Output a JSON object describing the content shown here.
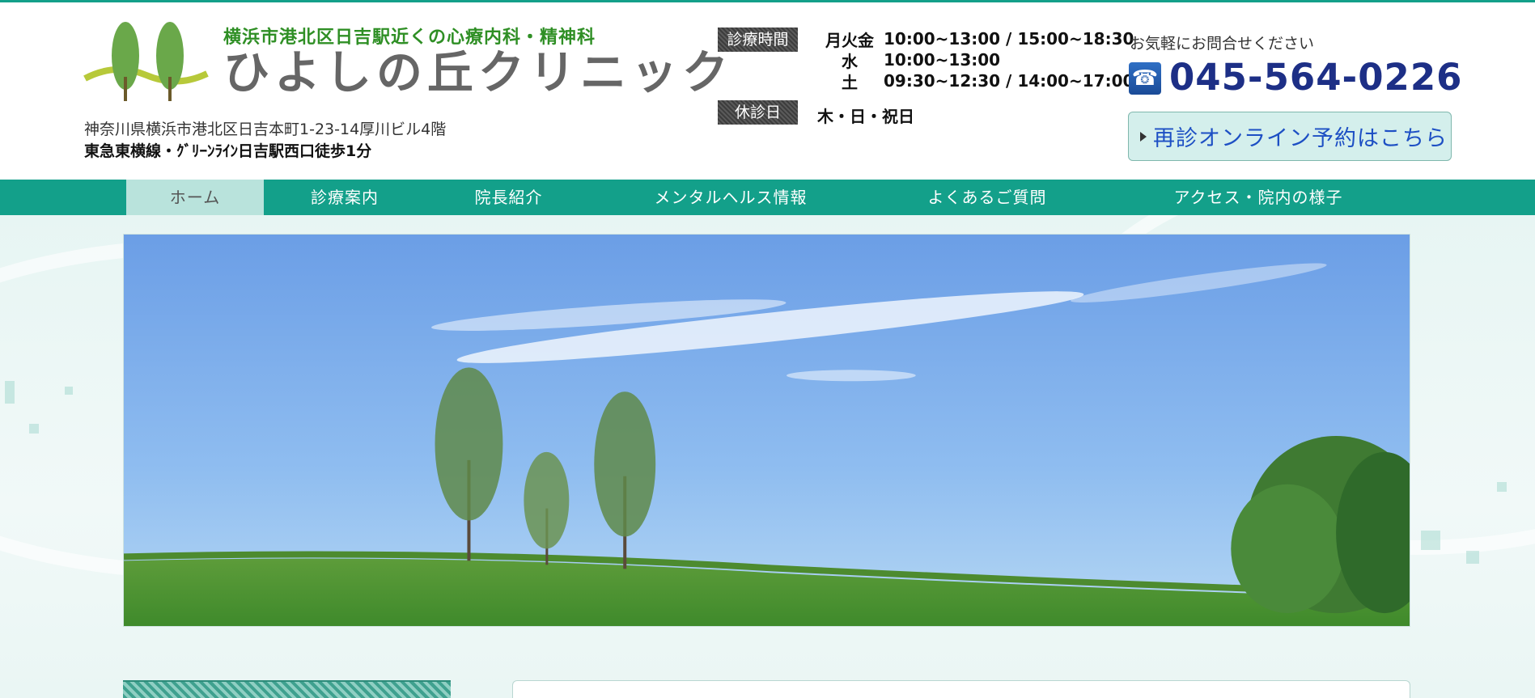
{
  "header": {
    "tagline": "横浜市港北区日吉駅近くの心療内科・精神科",
    "clinic_name": "ひよしの丘クリニック",
    "address": "神奈川県横浜市港北区日吉本町1-23-14厚川ビル4階",
    "access": "東急東横線・ｸﾞﾘｰﾝﾗｲﾝ日吉駅西口徒歩1分"
  },
  "hours": {
    "label": "診療時間",
    "rows": [
      {
        "days": "月火金",
        "time": "10:00~13:00 / 15:00~18:30"
      },
      {
        "days": "水",
        "time": "10:00~13:00"
      },
      {
        "days": "土",
        "time": "09:30~12:30 / 14:00~17:00"
      }
    ],
    "closed_label": "休診日",
    "closed_days": "木・日・祝日"
  },
  "contact": {
    "prompt": "お気軽にお問合せください",
    "phone_icon": "phone-icon",
    "phone": "045-564-0226",
    "reserve_label": "再診オンライン予約はこちら"
  },
  "nav": {
    "items": [
      {
        "label": "ホーム",
        "active": true
      },
      {
        "label": "診療案内",
        "active": false
      },
      {
        "label": "院長紹介",
        "active": false
      },
      {
        "label": "メンタルヘルス情報",
        "active": false
      },
      {
        "label": "よくあるご質問",
        "active": false
      },
      {
        "label": "アクセス・院内の様子",
        "active": false
      }
    ]
  },
  "colors": {
    "accent": "#13a08a",
    "nav_active": "#b9e3dc",
    "phone_text": "#1d2f86",
    "tagline": "#2f8f25"
  }
}
